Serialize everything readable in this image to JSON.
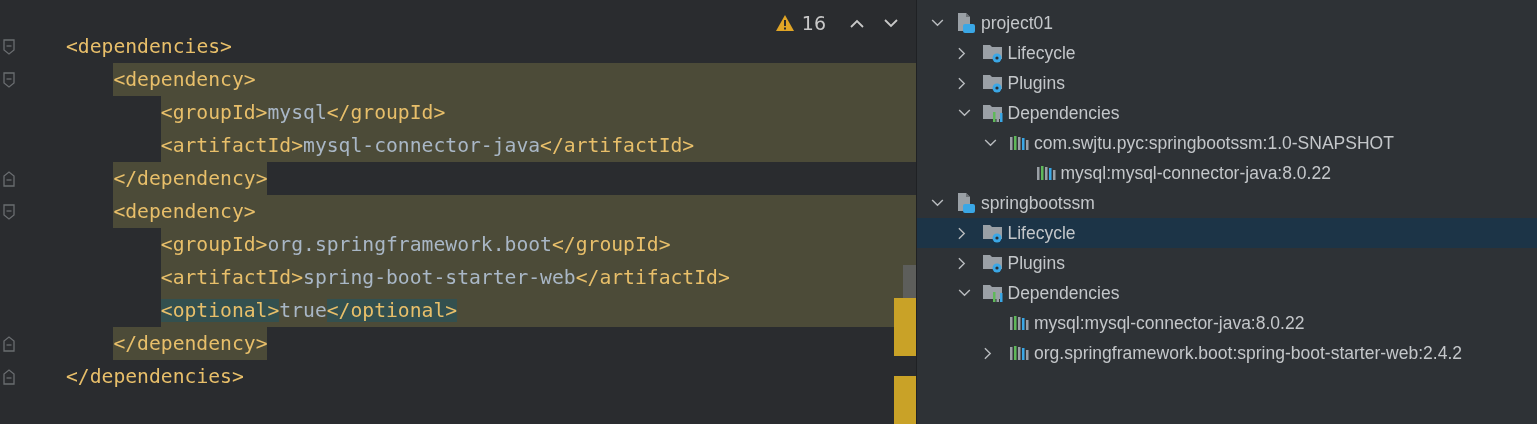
{
  "editor": {
    "inspections": {
      "warnings": "16"
    },
    "lines": [
      {
        "kind": "open",
        "highlighted": false,
        "segments": [
          {
            "kind": "tag",
            "text": "<dependencies>",
            "marked": false
          }
        ],
        "children": [
          {
            "kind": "open",
            "highlighted": true,
            "segments": [
              {
                "kind": "tag",
                "text": "<dependency>",
                "marked": false
              }
            ],
            "children": [
              {
                "kind": "plain",
                "highlighted": true,
                "segments": [
                  {
                    "kind": "tag",
                    "text": "<groupId>",
                    "marked": false
                  },
                  {
                    "kind": "value",
                    "text": "mysql",
                    "marked": false
                  },
                  {
                    "kind": "tag",
                    "text": "</groupId>",
                    "marked": false
                  }
                ]
              },
              {
                "kind": "plain",
                "highlighted": true,
                "segments": [
                  {
                    "kind": "tag",
                    "text": "<artifactId>",
                    "marked": false
                  },
                  {
                    "kind": "value",
                    "text": "mysql-connector-java",
                    "marked": false
                  },
                  {
                    "kind": "tag",
                    "text": "</artifactId>",
                    "marked": false
                  }
                ]
              }
            ]
          },
          {
            "kind": "close",
            "highlighted": true,
            "segments": [
              {
                "kind": "tag",
                "text": "</dependency>",
                "marked": false
              }
            ]
          },
          {
            "kind": "open",
            "highlighted": true,
            "segments": [
              {
                "kind": "tag",
                "text": "<dependency>",
                "marked": false
              }
            ],
            "children": [
              {
                "kind": "plain",
                "highlighted": true,
                "segments": [
                  {
                    "kind": "tag",
                    "text": "<groupId>",
                    "marked": false
                  },
                  {
                    "kind": "value",
                    "text": "org.springframework.boot",
                    "marked": false
                  },
                  {
                    "kind": "tag",
                    "text": "</groupId>",
                    "marked": false
                  }
                ]
              },
              {
                "kind": "plain",
                "highlighted": true,
                "segments": [
                  {
                    "kind": "tag",
                    "text": "<artifactId>",
                    "marked": false
                  },
                  {
                    "kind": "value",
                    "text": "spring-boot-starter-web",
                    "marked": false
                  },
                  {
                    "kind": "tag",
                    "text": "</artifactId>",
                    "marked": false
                  }
                ]
              },
              {
                "kind": "plain",
                "highlighted": true,
                "segments": [
                  {
                    "kind": "tag",
                    "text": "<optional>",
                    "marked": true
                  },
                  {
                    "kind": "value",
                    "text": "true",
                    "marked": false
                  },
                  {
                    "kind": "tag",
                    "text": "</optional>",
                    "marked": true
                  }
                ]
              }
            ]
          },
          {
            "kind": "close",
            "highlighted": true,
            "segments": [
              {
                "kind": "tag",
                "text": "</dependency>",
                "marked": false
              }
            ]
          }
        ]
      },
      {
        "kind": "close",
        "highlighted": false,
        "segments": [
          {
            "kind": "tag",
            "text": "</dependencies>",
            "marked": false
          }
        ]
      }
    ]
  },
  "maven_tree": [
    {
      "label": "project01",
      "kind": "project",
      "expanded": true,
      "selected": false,
      "children": [
        {
          "label": "Lifecycle",
          "kind": "gear-folder",
          "expanded": false,
          "selected": false
        },
        {
          "label": "Plugins",
          "kind": "gear-folder",
          "expanded": false,
          "selected": false
        },
        {
          "label": "Dependencies",
          "kind": "deps-folder",
          "expanded": true,
          "selected": false,
          "children": [
            {
              "label": "com.swjtu.pyc:springbootssm:1.0-SNAPSHOT",
              "kind": "library",
              "expanded": true,
              "selected": false,
              "children": [
                {
                  "label": "mysql:mysql-connector-java:8.0.22",
                  "kind": "library",
                  "selected": false
                }
              ]
            }
          ]
        }
      ]
    },
    {
      "label": "springbootssm",
      "kind": "project",
      "expanded": true,
      "selected": false,
      "children": [
        {
          "label": "Lifecycle",
          "kind": "gear-folder",
          "expanded": false,
          "selected": true
        },
        {
          "label": "Plugins",
          "kind": "gear-folder",
          "expanded": false,
          "selected": false
        },
        {
          "label": "Dependencies",
          "kind": "deps-folder",
          "expanded": true,
          "selected": false,
          "children": [
            {
              "label": "mysql:mysql-connector-java:8.0.22",
              "kind": "library",
              "selected": false
            },
            {
              "label": "org.springframework.boot:spring-boot-starter-web:2.4.2",
              "kind": "library",
              "expanded": false,
              "selected": false
            }
          ]
        }
      ]
    }
  ]
}
